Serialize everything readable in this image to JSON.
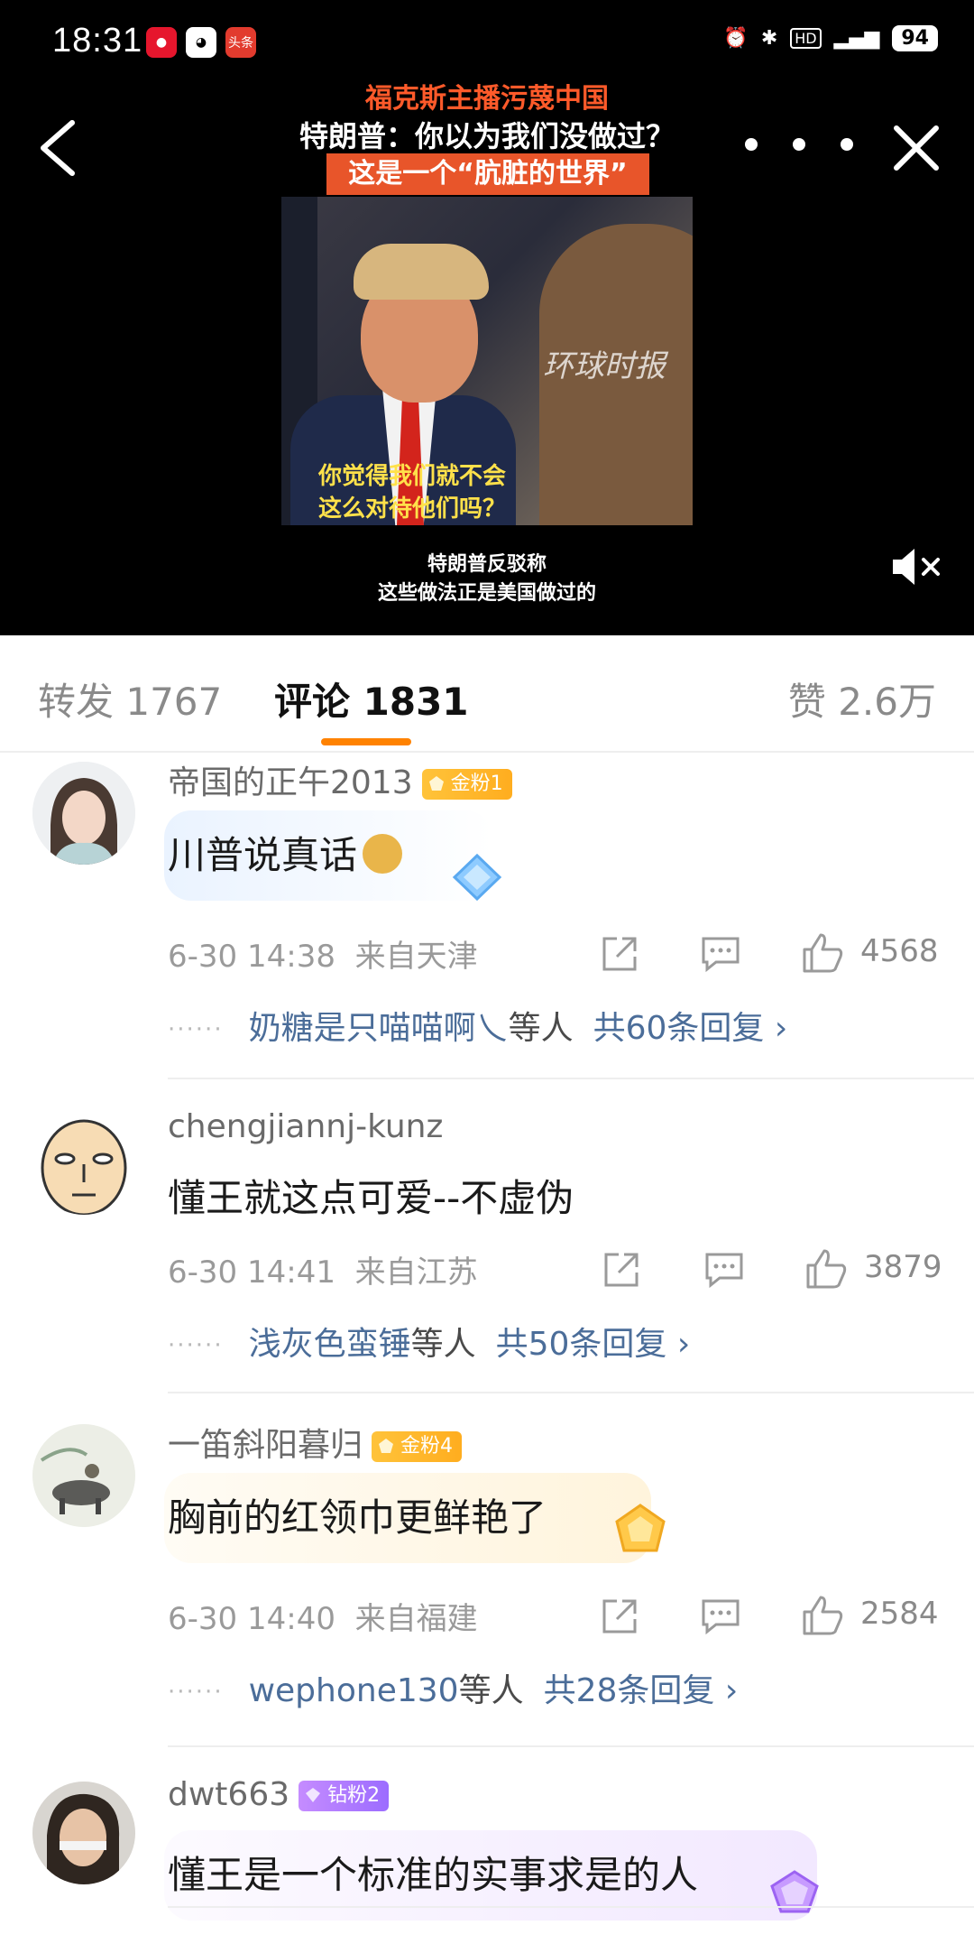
{
  "status": {
    "time": "18:31",
    "battery": "94",
    "apps": [
      "weibo",
      "cat",
      "头条"
    ]
  },
  "video": {
    "title_red": "福克斯主播污蔑中国",
    "title_white": "特朗普：你以为我们没做过？",
    "title_box": "这是一个“肮脏的世界”",
    "watermark": "环球时报",
    "subtitle_line1": "你觉得我们就不会",
    "subtitle_line2": "这么对待他们吗？",
    "caption_line1": "特朗普反驳称",
    "caption_line2": "这些做法正是美国做过的"
  },
  "tabs": {
    "repost": "转发 1767",
    "comment": "评论 1831",
    "like": "赞 2.6万"
  },
  "colors": {
    "accent": "#ff8200",
    "link": "#4b6d99",
    "gold_badge": "#ffb22a",
    "diamond_badge": "#a777ff"
  },
  "comments": [
    {
      "username": "帝国的正午2013",
      "badge": "金粉1",
      "badge_type": "gold",
      "text": "川普说真话",
      "emoji": "doge-emoji",
      "date": "6-30 14:38",
      "location": "来自天津",
      "likes": "4568",
      "reply_users": "奶糖是只喵喵啊乀",
      "reply_etc": "等人",
      "reply_total": "共60条回复 ›"
    },
    {
      "username": "chengjiannj-kunz",
      "badge": "",
      "badge_type": "",
      "text": "懂王就这点可爱--不虚伪",
      "date": "6-30 14:41",
      "location": "来自江苏",
      "likes": "3879",
      "reply_users": "浅灰色蛮锤",
      "reply_etc": "等人",
      "reply_total": "共50条回复 ›"
    },
    {
      "username": "一笛斜阳暮归",
      "badge": "金粉4",
      "badge_type": "gold",
      "text": "胸前的红领巾更鲜艳了",
      "date": "6-30 14:40",
      "location": "来自福建",
      "likes": "2584",
      "reply_users": "wephone130",
      "reply_etc": "等人",
      "reply_total": "共28条回复 ›"
    },
    {
      "username": "dwt663",
      "badge": "钻粉2",
      "badge_type": "diamond",
      "text": "懂王是一个标准的实事求是的人"
    }
  ]
}
